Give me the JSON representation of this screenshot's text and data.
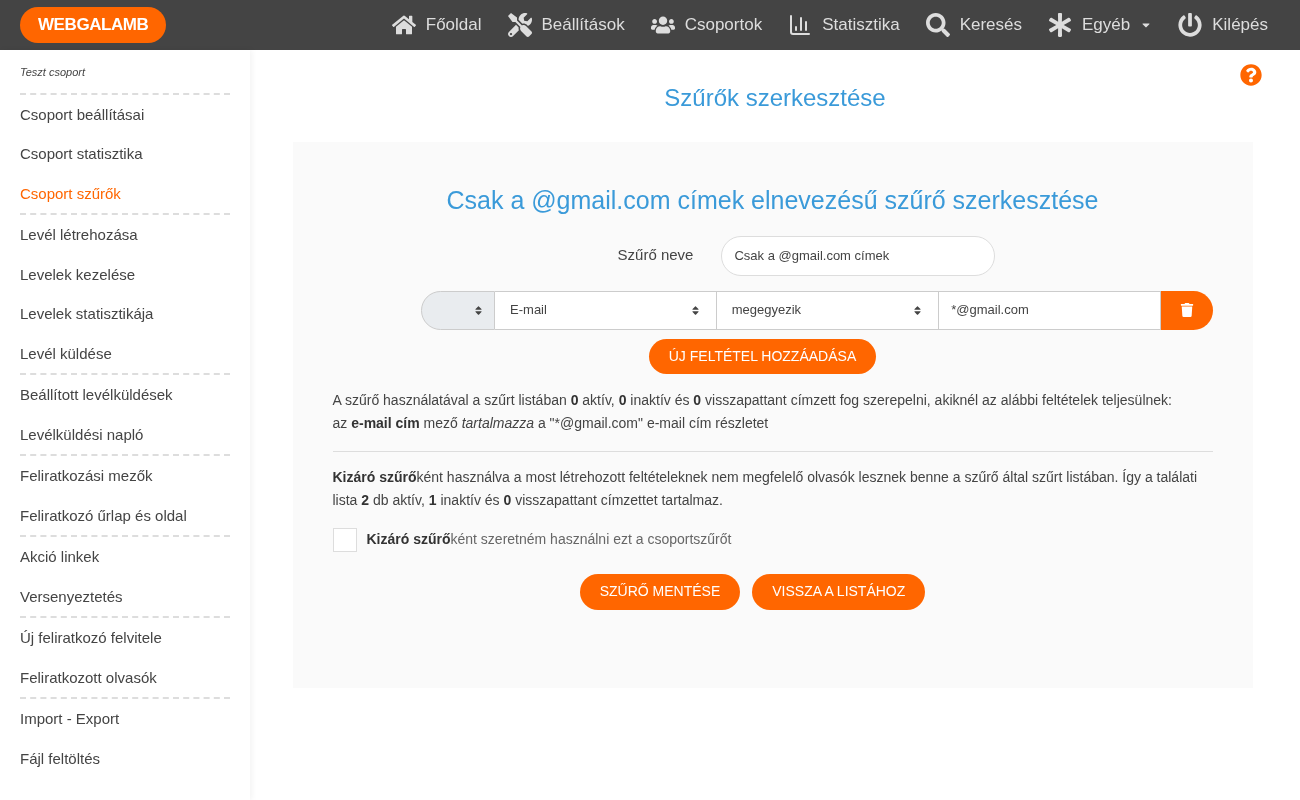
{
  "header": {
    "logo": "WEBGALAMB",
    "nav": [
      {
        "label": "Főoldal",
        "kind": "home",
        "dropdown": false
      },
      {
        "label": "Beállítások",
        "kind": "tools",
        "dropdown": false
      },
      {
        "label": "Csoportok",
        "kind": "users",
        "dropdown": false
      },
      {
        "label": "Statisztika",
        "kind": "chart",
        "dropdown": false
      },
      {
        "label": "Keresés",
        "kind": "search",
        "dropdown": false
      },
      {
        "label": "Egyéb",
        "kind": "other",
        "dropdown": true
      },
      {
        "label": "Kilépés",
        "kind": "logout",
        "dropdown": false
      }
    ]
  },
  "sidebar": {
    "title": "Teszt csoport",
    "groups": [
      [
        {
          "label": "Csoport beállításai",
          "selected": false
        },
        {
          "label": "Csoport statisztika",
          "selected": false
        },
        {
          "label": "Csoport szűrők",
          "selected": true
        }
      ],
      [
        {
          "label": "Levél létrehozása",
          "selected": false
        },
        {
          "label": "Levelek kezelése",
          "selected": false
        },
        {
          "label": "Levelek statisztikája",
          "selected": false
        },
        {
          "label": "Levél küldése",
          "selected": false
        }
      ],
      [
        {
          "label": "Beállított levélküldések",
          "selected": false
        },
        {
          "label": "Levélküldési napló",
          "selected": false
        }
      ],
      [
        {
          "label": "Feliratkozási mezők",
          "selected": false
        },
        {
          "label": "Feliratkozó űrlap és oldal",
          "selected": false
        }
      ],
      [
        {
          "label": "Akció linkek",
          "selected": false
        },
        {
          "label": "Versenyeztetés",
          "selected": false
        }
      ],
      [
        {
          "label": "Új feliratkozó felvitele",
          "selected": false
        },
        {
          "label": "Feliratkozott olvasók",
          "selected": false
        }
      ],
      [
        {
          "label": "Import - Export",
          "selected": false
        },
        {
          "label": "Fájl feltöltés",
          "selected": false
        }
      ]
    ]
  },
  "page_title": "Szűrők szerkesztése",
  "card": {
    "title": "Csak a @gmail.com címek elnevezésű szűrő szerkesztése",
    "name_label": "Szűrő neve",
    "name_value": "Csak a @gmail.com címek",
    "condition": {
      "field": "E-mail",
      "operator": "megegyezik",
      "value": "*@gmail.com"
    },
    "add_button": "ÚJ FELTÉTEL HOZZÁADÁSA",
    "summary": [
      "A szűrő használatával a szűrt listában **0** aktív, **0** inaktív és **0** visszapattant címzett fog szerepelni, akiknél az alábbi feltételek teljesülnek:",
      "az **e-mail cím** mező *tartalmazza* a \"*@gmail.com\" e-mail cím részletet"
    ],
    "exclusion": "**Kizáró szűrő**ként használva a most létrehozott feltételeknek nem megfelelő olvasók lesznek benne a szűrő által szűrt listában. Így a találati lista **2** db aktív, **1** inaktív és **0** visszapattant címzettet tartalmaz.",
    "checkbox": {
      "checked": false,
      "label": "**Kizáró szűrő**ként szeretném használni ezt a csoportszűrőt"
    },
    "buttons": [
      "SZŰRŐ MENTÉSE",
      "VISSZA A LISTÁHOZ"
    ]
  }
}
